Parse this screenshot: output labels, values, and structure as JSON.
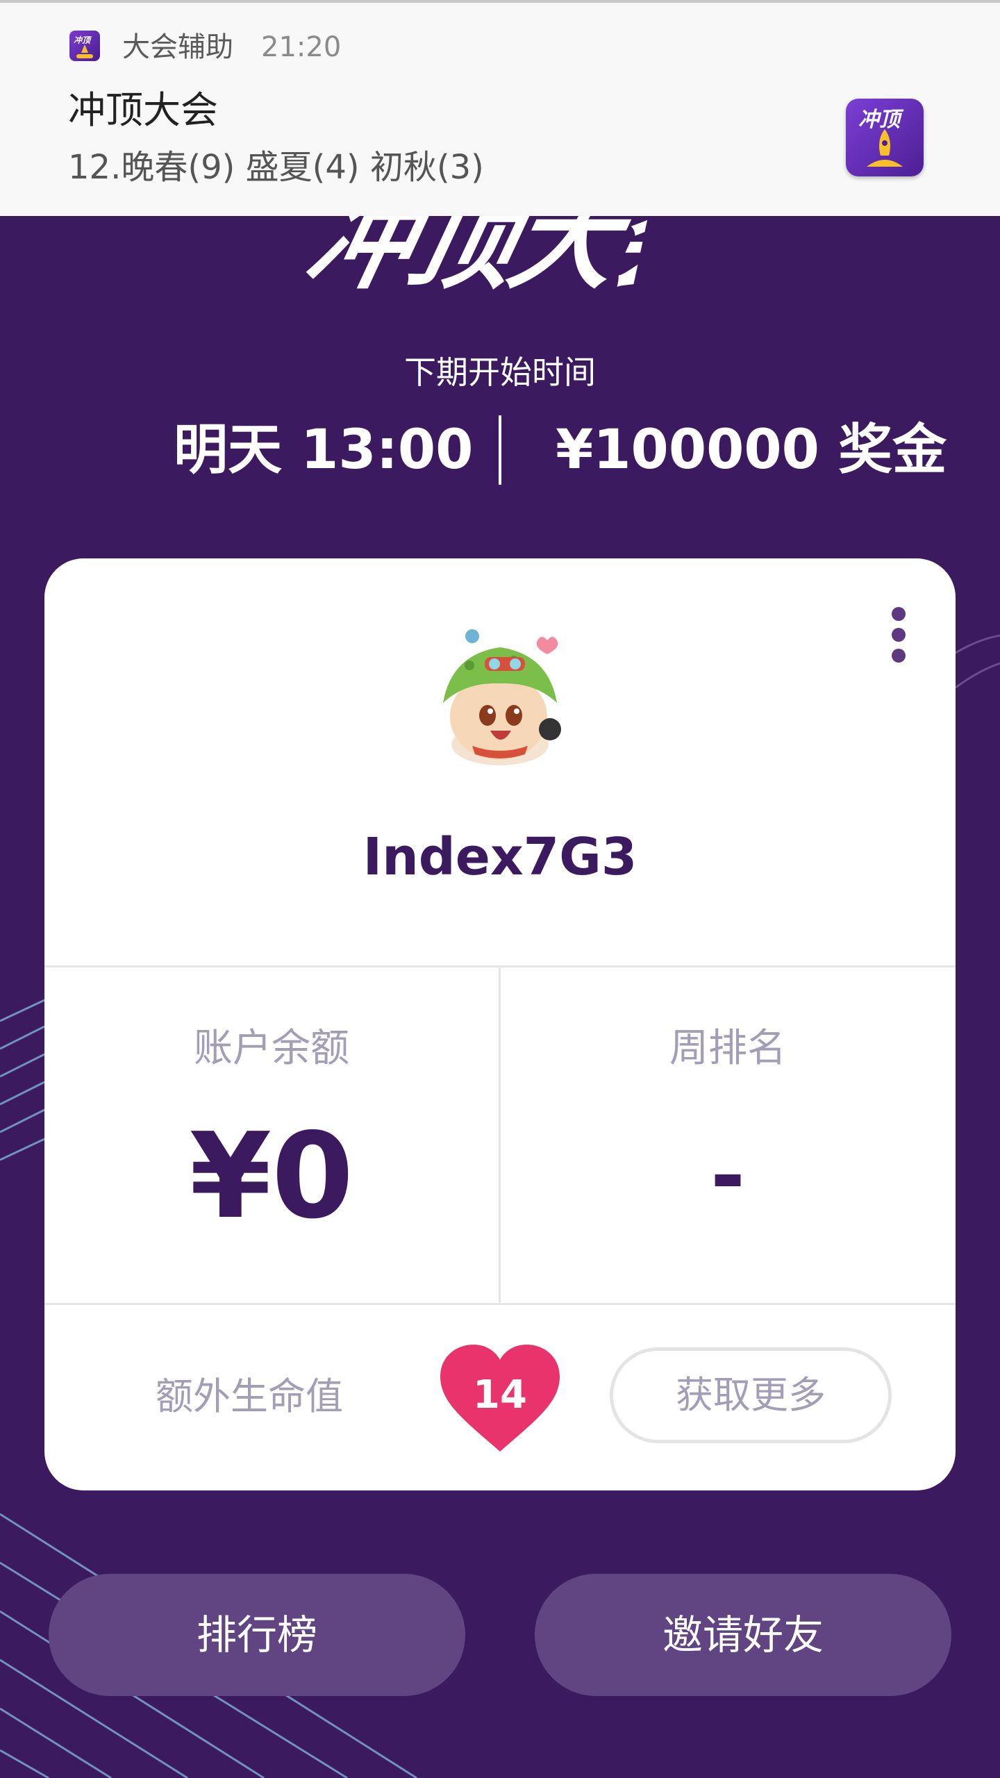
{
  "notification": {
    "app_name": "大会辅助",
    "time": "21:20",
    "title": "冲顶大会",
    "text": "12.晚春(9) 盛夏(4) 初秋(3)",
    "icon_label": "冲顶"
  },
  "header": {
    "logo_text": "冲顶大会",
    "next_label": "下期开始时间",
    "next_time": "明天 13:00",
    "prize": "¥100000 奖金"
  },
  "card": {
    "username": "Index7G3",
    "balance_label": "账户余额",
    "balance_value": "¥0",
    "rank_label": "周排名",
    "rank_value": "-",
    "extra_lives_label": "额外生命值",
    "extra_lives_count": "14",
    "get_more_label": "获取更多"
  },
  "bottom": {
    "leaderboard_label": "排行榜",
    "invite_label": "邀请好友"
  },
  "colors": {
    "background": "#3b1a5f",
    "accent": "#e8336d",
    "button": "#614582"
  }
}
